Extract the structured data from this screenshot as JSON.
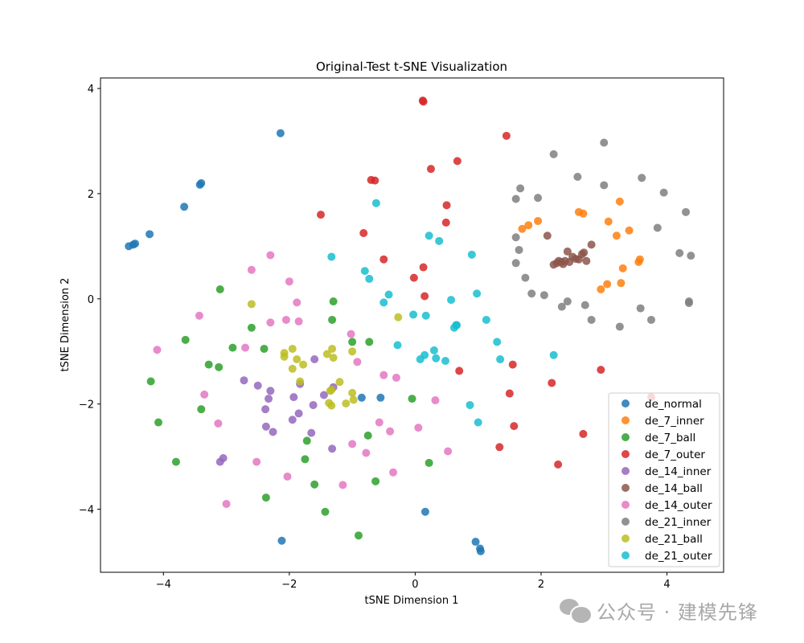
{
  "chart_data": {
    "type": "scatter",
    "title": "Original-Test t-SNE Visualization",
    "xlabel": "tSNE Dimension 1",
    "ylabel": "tSNE Dimension 2",
    "xlim": [
      -5.0,
      4.9
    ],
    "ylim": [
      -5.2,
      4.2
    ],
    "xticks": [
      -4,
      -2,
      0,
      2,
      4
    ],
    "yticks": [
      -4,
      -2,
      0,
      2,
      4
    ],
    "xtick_labels": [
      "−4",
      "−2",
      "0",
      "2",
      "4"
    ],
    "ytick_labels": [
      "−4",
      "−2",
      "0",
      "2",
      "4"
    ],
    "grid": false,
    "legend_position": "lower-right",
    "series": [
      {
        "name": "de_normal",
        "color": "#1f77b4",
        "points": [
          [
            -4.55,
            1.0
          ],
          [
            -4.48,
            1.03
          ],
          [
            -4.45,
            1.05
          ],
          [
            -4.22,
            1.23
          ],
          [
            -3.67,
            1.75
          ],
          [
            -3.42,
            2.17
          ],
          [
            -3.4,
            2.2
          ],
          [
            -2.14,
            3.15
          ],
          [
            -0.85,
            -1.88
          ],
          [
            -0.55,
            -1.88
          ],
          [
            0.16,
            -4.05
          ],
          [
            -2.12,
            -4.6
          ],
          [
            0.96,
            -4.62
          ],
          [
            1.03,
            -4.75
          ],
          [
            1.04,
            -4.8
          ]
        ]
      },
      {
        "name": "de_7_inner",
        "color": "#ff7f0e",
        "points": [
          [
            1.7,
            1.33
          ],
          [
            1.8,
            1.4
          ],
          [
            1.95,
            1.48
          ],
          [
            2.6,
            1.65
          ],
          [
            2.67,
            1.62
          ],
          [
            3.07,
            1.47
          ],
          [
            3.25,
            1.85
          ],
          [
            3.2,
            1.2
          ],
          [
            3.4,
            1.3
          ],
          [
            3.55,
            0.7
          ],
          [
            3.57,
            0.75
          ],
          [
            3.3,
            0.58
          ],
          [
            3.27,
            0.3
          ],
          [
            3.05,
            0.28
          ],
          [
            2.95,
            0.18
          ]
        ]
      },
      {
        "name": "de_7_ball",
        "color": "#2ca02c",
        "points": [
          [
            -3.1,
            0.18
          ],
          [
            -2.6,
            -0.55
          ],
          [
            -2.4,
            -0.95
          ],
          [
            -1.3,
            -0.05
          ],
          [
            -1.32,
            -0.4
          ],
          [
            -1.0,
            -0.82
          ],
          [
            -0.73,
            -0.82
          ],
          [
            -3.65,
            -0.78
          ],
          [
            -3.28,
            -1.25
          ],
          [
            -3.12,
            -1.3
          ],
          [
            -2.9,
            -0.93
          ],
          [
            -4.2,
            -1.57
          ],
          [
            -3.4,
            -2.1
          ],
          [
            -4.08,
            -2.35
          ],
          [
            -3.8,
            -3.1
          ],
          [
            -0.05,
            -1.9
          ],
          [
            -1.72,
            -2.7
          ],
          [
            -1.75,
            -3.05
          ],
          [
            -0.75,
            -2.6
          ],
          [
            -1.6,
            -3.53
          ],
          [
            -0.63,
            -3.47
          ],
          [
            -1.43,
            -4.05
          ],
          [
            -0.9,
            -4.5
          ],
          [
            0.22,
            -3.12
          ],
          [
            -2.37,
            -3.78
          ]
        ]
      },
      {
        "name": "de_7_outer",
        "color": "#d62728",
        "points": [
          [
            0.12,
            3.77
          ],
          [
            0.13,
            3.75
          ],
          [
            1.45,
            3.1
          ],
          [
            0.67,
            2.62
          ],
          [
            0.25,
            2.47
          ],
          [
            -0.7,
            2.26
          ],
          [
            -0.64,
            2.25
          ],
          [
            0.5,
            1.78
          ],
          [
            0.49,
            1.45
          ],
          [
            -1.5,
            1.6
          ],
          [
            -0.82,
            1.25
          ],
          [
            -0.5,
            0.75
          ],
          [
            0.13,
            0.6
          ],
          [
            -0.02,
            0.4
          ],
          [
            0.15,
            0.05
          ],
          [
            0.7,
            -1.37
          ],
          [
            1.55,
            -1.25
          ],
          [
            2.17,
            -1.6
          ],
          [
            2.95,
            -1.35
          ],
          [
            1.5,
            -1.8
          ],
          [
            1.57,
            -2.42
          ],
          [
            1.34,
            -2.82
          ],
          [
            2.67,
            -2.57
          ],
          [
            2.27,
            -3.15
          ],
          [
            3.75,
            -1.87
          ]
        ]
      },
      {
        "name": "de_14_inner",
        "color": "#9467bd",
        "points": [
          [
            -2.72,
            -1.55
          ],
          [
            -2.5,
            -1.65
          ],
          [
            -2.3,
            -1.75
          ],
          [
            -2.33,
            -1.9
          ],
          [
            -2.38,
            -2.1
          ],
          [
            -1.93,
            -1.87
          ],
          [
            -1.85,
            -2.18
          ],
          [
            -1.95,
            -2.3
          ],
          [
            -2.37,
            -2.43
          ],
          [
            -2.26,
            -2.53
          ],
          [
            -1.6,
            -1.15
          ],
          [
            -1.62,
            -2.02
          ],
          [
            -1.45,
            -1.83
          ],
          [
            -1.3,
            -1.68
          ],
          [
            -1.65,
            -2.55
          ],
          [
            -1.32,
            -2.85
          ],
          [
            -3.05,
            -3.03
          ],
          [
            -3.1,
            -3.1
          ],
          [
            -1.83,
            -1.62
          ]
        ]
      },
      {
        "name": "de_14_ball",
        "color": "#8c564b",
        "points": [
          [
            2.1,
            1.2
          ],
          [
            2.8,
            1.03
          ],
          [
            2.28,
            0.72
          ],
          [
            2.2,
            0.65
          ],
          [
            2.25,
            0.68
          ],
          [
            2.32,
            0.7
          ],
          [
            2.38,
            0.72
          ],
          [
            2.42,
            0.9
          ],
          [
            2.5,
            0.8
          ],
          [
            2.55,
            0.76
          ],
          [
            2.6,
            0.75
          ],
          [
            2.65,
            0.85
          ],
          [
            2.68,
            0.88
          ],
          [
            2.72,
            0.72
          ],
          [
            2.45,
            0.7
          ],
          [
            2.35,
            0.66
          ]
        ]
      },
      {
        "name": "de_14_outer",
        "color": "#e377c2",
        "points": [
          [
            -2.3,
            0.83
          ],
          [
            -2.6,
            0.55
          ],
          [
            -2.0,
            0.33
          ],
          [
            -1.88,
            -0.07
          ],
          [
            -2.05,
            -0.4
          ],
          [
            -1.85,
            -0.43
          ],
          [
            -2.3,
            -0.45
          ],
          [
            -3.43,
            -0.32
          ],
          [
            -4.1,
            -0.97
          ],
          [
            -2.7,
            -0.93
          ],
          [
            -1.02,
            -0.67
          ],
          [
            -0.92,
            -1.2
          ],
          [
            -0.5,
            -1.45
          ],
          [
            -0.3,
            -1.5
          ],
          [
            -3.35,
            -1.82
          ],
          [
            -3.13,
            -2.37
          ],
          [
            -0.57,
            -2.35
          ],
          [
            -0.4,
            -2.52
          ],
          [
            -0.78,
            -2.93
          ],
          [
            -1.0,
            -2.76
          ],
          [
            -0.35,
            -3.3
          ],
          [
            0.32,
            -1.93
          ],
          [
            0.05,
            -2.45
          ],
          [
            0.52,
            -2.9
          ],
          [
            -2.52,
            -3.1
          ],
          [
            -2.03,
            -3.38
          ],
          [
            -1.15,
            -3.54
          ],
          [
            -3.0,
            -3.9
          ]
        ]
      },
      {
        "name": "de_21_inner",
        "color": "#7f7f7f",
        "points": [
          [
            2.2,
            2.75
          ],
          [
            3.0,
            2.97
          ],
          [
            1.67,
            2.1
          ],
          [
            1.95,
            1.92
          ],
          [
            2.58,
            2.32
          ],
          [
            3.0,
            2.16
          ],
          [
            3.6,
            2.3
          ],
          [
            3.95,
            2.02
          ],
          [
            1.6,
            1.9
          ],
          [
            1.6,
            1.17
          ],
          [
            1.65,
            0.93
          ],
          [
            1.6,
            0.68
          ],
          [
            1.75,
            0.4
          ],
          [
            1.85,
            0.1
          ],
          [
            2.05,
            0.07
          ],
          [
            2.33,
            -0.15
          ],
          [
            2.42,
            -0.05
          ],
          [
            2.7,
            -0.12
          ],
          [
            2.8,
            -0.4
          ],
          [
            3.25,
            -0.53
          ],
          [
            3.58,
            -0.18
          ],
          [
            3.75,
            -0.4
          ],
          [
            3.85,
            1.35
          ],
          [
            4.2,
            0.87
          ],
          [
            4.38,
            0.82
          ],
          [
            4.3,
            1.65
          ],
          [
            4.35,
            -0.05
          ],
          [
            4.35,
            -0.08
          ]
        ]
      },
      {
        "name": "de_21_ball",
        "color": "#bcbd22",
        "points": [
          [
            -2.6,
            -0.1
          ],
          [
            -2.08,
            -1.03
          ],
          [
            -2.08,
            -1.1
          ],
          [
            -1.95,
            -0.95
          ],
          [
            -1.88,
            -1.15
          ],
          [
            -1.78,
            -1.25
          ],
          [
            -1.95,
            -1.33
          ],
          [
            -1.4,
            -1.05
          ],
          [
            -1.32,
            -0.95
          ],
          [
            -1.3,
            -1.12
          ],
          [
            -1.83,
            -1.57
          ],
          [
            -1.2,
            -1.58
          ],
          [
            -1.35,
            -1.75
          ],
          [
            -1.33,
            -1.73
          ],
          [
            -1.0,
            -1.0
          ],
          [
            -1.0,
            -1.79
          ],
          [
            -1.37,
            -1.98
          ],
          [
            -1.33,
            -2.03
          ],
          [
            -1.1,
            -1.99
          ],
          [
            -0.98,
            -1.92
          ],
          [
            -0.27,
            -0.35
          ]
        ]
      },
      {
        "name": "de_21_outer",
        "color": "#17becf",
        "points": [
          [
            -0.62,
            1.82
          ],
          [
            -1.33,
            0.8
          ],
          [
            -0.8,
            0.53
          ],
          [
            -0.73,
            0.38
          ],
          [
            -0.42,
            0.08
          ],
          [
            -0.5,
            -0.07
          ],
          [
            0.22,
            1.2
          ],
          [
            0.38,
            1.1
          ],
          [
            0.9,
            0.84
          ],
          [
            0.57,
            -0.02
          ],
          [
            0.98,
            0.1
          ],
          [
            1.13,
            -0.4
          ],
          [
            -0.03,
            -0.3
          ],
          [
            0.17,
            -0.32
          ],
          [
            -0.28,
            -0.88
          ],
          [
            0.65,
            -0.5
          ],
          [
            0.62,
            -0.55
          ],
          [
            0.66,
            -0.5
          ],
          [
            0.15,
            -1.07
          ],
          [
            0.08,
            -1.15
          ],
          [
            0.3,
            -0.98
          ],
          [
            0.33,
            -1.13
          ],
          [
            0.48,
            -1.18
          ],
          [
            1.3,
            -0.82
          ],
          [
            1.35,
            -1.15
          ],
          [
            2.2,
            -1.07
          ],
          [
            0.87,
            -2.02
          ],
          [
            1.0,
            -2.35
          ]
        ]
      }
    ]
  },
  "watermark": {
    "icon": "wechat-icon",
    "text": "公众号 · 建模先锋"
  }
}
